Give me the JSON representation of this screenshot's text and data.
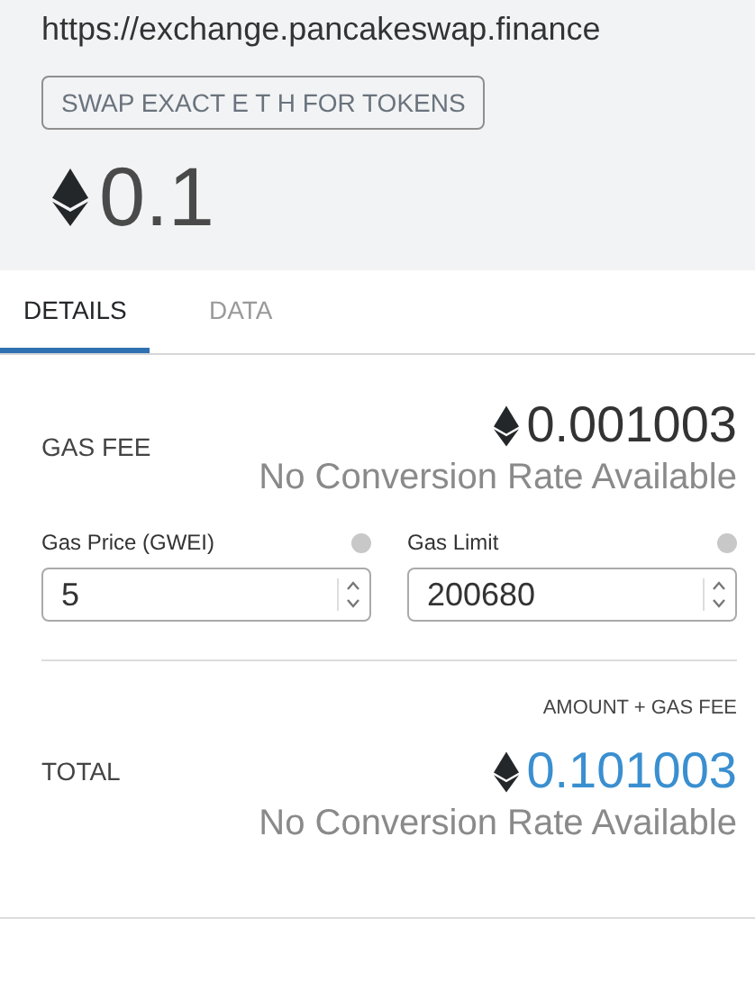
{
  "origin": "https://exchange.pancakeswap.finance",
  "method_badge": "SWAP EXACT E T H FOR TOKENS",
  "amount": {
    "value": "0.1"
  },
  "tabs": [
    {
      "label": "DETAILS",
      "selected": true
    },
    {
      "label": "DATA",
      "selected": false
    }
  ],
  "gas_fee": {
    "label": "GAS FEE",
    "value": "0.001003",
    "conversion": "No Conversion Rate Available"
  },
  "gas_inputs": [
    {
      "label": "Gas Price (GWEI)",
      "value": "5"
    },
    {
      "label": "Gas Limit",
      "value": "200680"
    }
  ],
  "total": {
    "caption": "AMOUNT + GAS FEE",
    "label": "TOTAL",
    "value": "0.101003",
    "conversion": "No Conversion Rate Available"
  }
}
